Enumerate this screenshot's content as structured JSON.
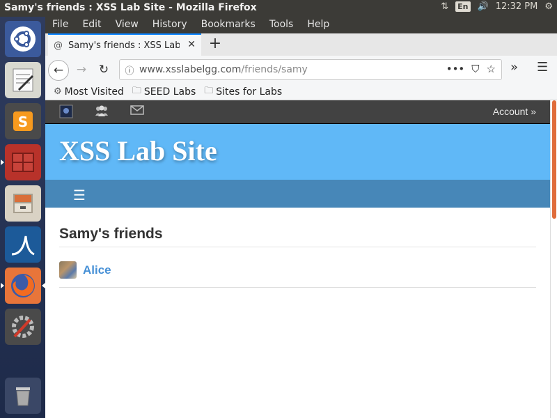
{
  "window": {
    "title": "Samy's friends : XSS Lab Site - Mozilla Firefox"
  },
  "system_tray": {
    "language": "En",
    "clock": "12:32 PM"
  },
  "launcher": {
    "items": [
      {
        "name": "ubuntu-dash-icon"
      },
      {
        "name": "text-editor-icon"
      },
      {
        "name": "sublime-text-icon"
      },
      {
        "name": "terminal-icon"
      },
      {
        "name": "files-icon"
      },
      {
        "name": "wireshark-icon"
      },
      {
        "name": "firefox-icon"
      },
      {
        "name": "system-settings-icon"
      },
      {
        "name": "trash-icon"
      }
    ]
  },
  "menubar": {
    "items": [
      "File",
      "Edit",
      "View",
      "History",
      "Bookmarks",
      "Tools",
      "Help"
    ]
  },
  "tab": {
    "title": "Samy's friends : XSS Lab",
    "close": "✕",
    "new": "+"
  },
  "url": {
    "host": "www.xsslabelgg.com",
    "path": "/friends/samy"
  },
  "bookmarks": [
    "Most Visited",
    "SEED Labs",
    "Sites for Labs"
  ],
  "site": {
    "account_label": "Account »",
    "title": "XSS Lab Site",
    "page_heading": "Samy's friends",
    "friends": [
      {
        "name": "Alice"
      }
    ]
  },
  "colors": {
    "header": "#60b8f7",
    "nav": "#4787b8",
    "topbar": "#424242",
    "link": "#4690d6"
  }
}
